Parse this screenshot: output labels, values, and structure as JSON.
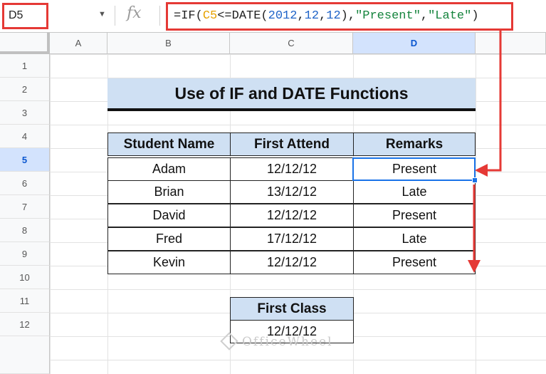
{
  "name_box": "D5",
  "formula": {
    "p1": "=IF(",
    "ref": "C5",
    "p2": "<=DATE(",
    "n1": "2012",
    "c1": ",",
    "n2": "12",
    "c2": ",",
    "n3": "12",
    "p3": "),",
    "s1": "\"Present\"",
    "c3": ",",
    "s2": "\"Late\"",
    "p4": ")"
  },
  "fx_label": "fx",
  "columns": [
    "A",
    "B",
    "C",
    "D"
  ],
  "rows": [
    "1",
    "2",
    "3",
    "4",
    "5",
    "6",
    "7",
    "8",
    "9",
    "10",
    "11",
    "12"
  ],
  "title": "Use of IF and DATE Functions",
  "table": {
    "headers": [
      "Student Name",
      "First Attend",
      "Remarks"
    ],
    "rows": [
      [
        "Adam",
        "12/12/12",
        "Present"
      ],
      [
        "Brian",
        "13/12/12",
        "Late"
      ],
      [
        "David",
        "12/12/12",
        "Present"
      ],
      [
        "Fred",
        "17/12/12",
        "Late"
      ],
      [
        "Kevin",
        "12/12/12",
        "Present"
      ]
    ]
  },
  "first_class": {
    "header": "First Class",
    "value": "12/12/12"
  },
  "watermark": "OfficeWheel",
  "colors": {
    "highlight_red": "#e53935",
    "header_fill": "#cfe0f3",
    "selection_blue": "#1a73e8"
  }
}
